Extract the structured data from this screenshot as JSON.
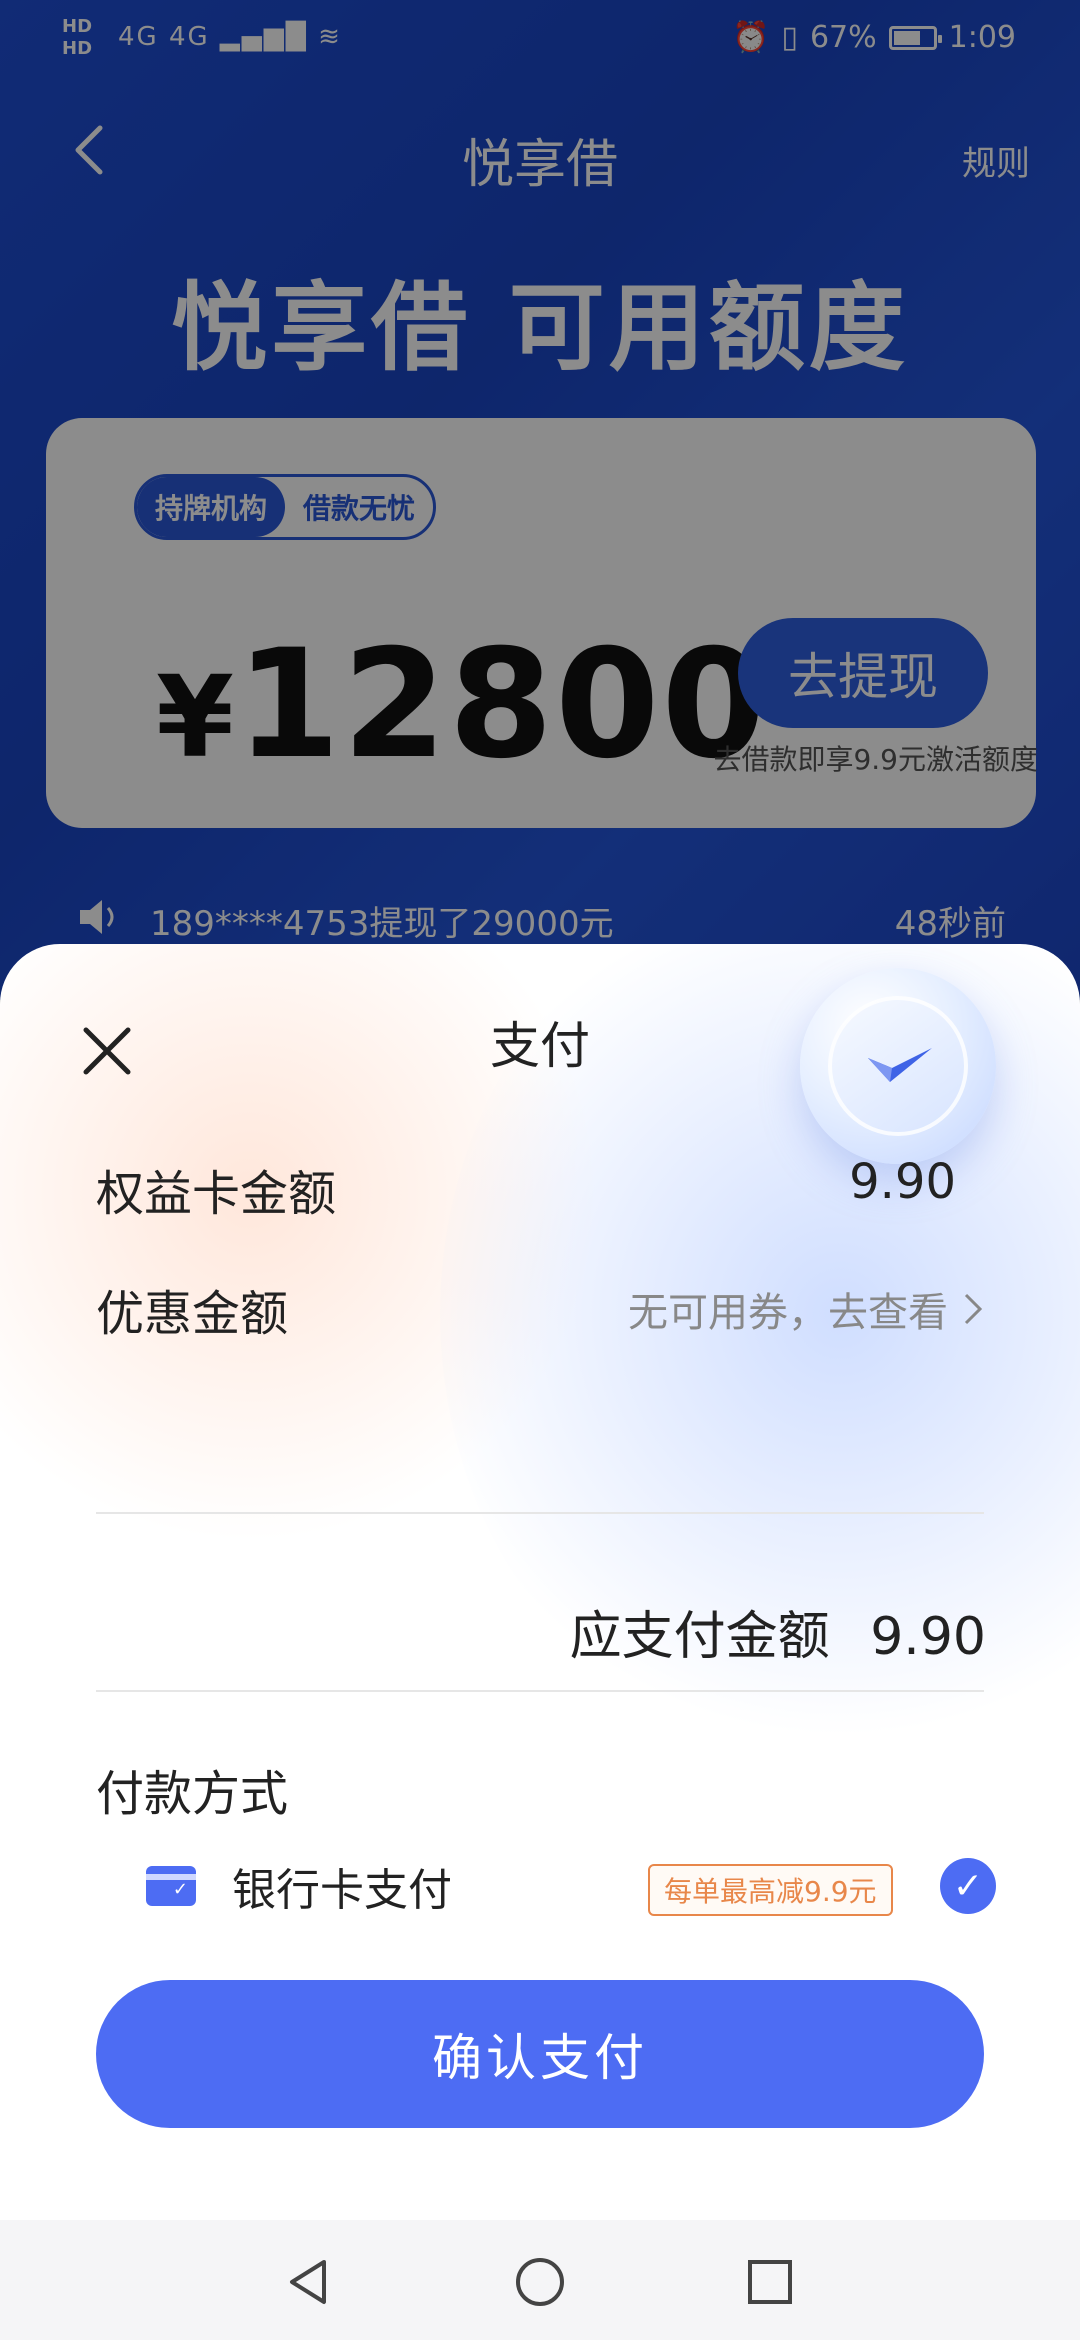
{
  "status_bar": {
    "left_labels": [
      "HD",
      "HD"
    ],
    "network": "4G 4G",
    "battery_percent": "67%",
    "battery_level": 0.67,
    "time": "1:09"
  },
  "header": {
    "title": "悦享借",
    "rules_label": "规则"
  },
  "headline": "悦享借 可用额度",
  "credit_card": {
    "tag_primary": "持牌机构",
    "tag_secondary": "借款无忧",
    "currency": "¥",
    "amount": "12800",
    "withdraw_label": "去提现",
    "tip": "去借款即享9.9元激活额度"
  },
  "ticker": {
    "message": "189****4753提现了29000元",
    "time_ago": "48秒前"
  },
  "payment_sheet": {
    "title": "支付",
    "benefit_label": "权益卡金额",
    "benefit_value": "9.90",
    "discount_label": "优惠金额",
    "discount_value": "无可用券，去查看",
    "due_label": "应支付金额",
    "due_value": "9.90",
    "method_title": "付款方式",
    "method_label": "银行卡支付",
    "method_promo": "每单最高减9.9元",
    "confirm_label": "确认支付"
  },
  "colors": {
    "primary": "#4d6cf3",
    "background_blue": "#1f4fd6",
    "promo": "#e8874a"
  }
}
